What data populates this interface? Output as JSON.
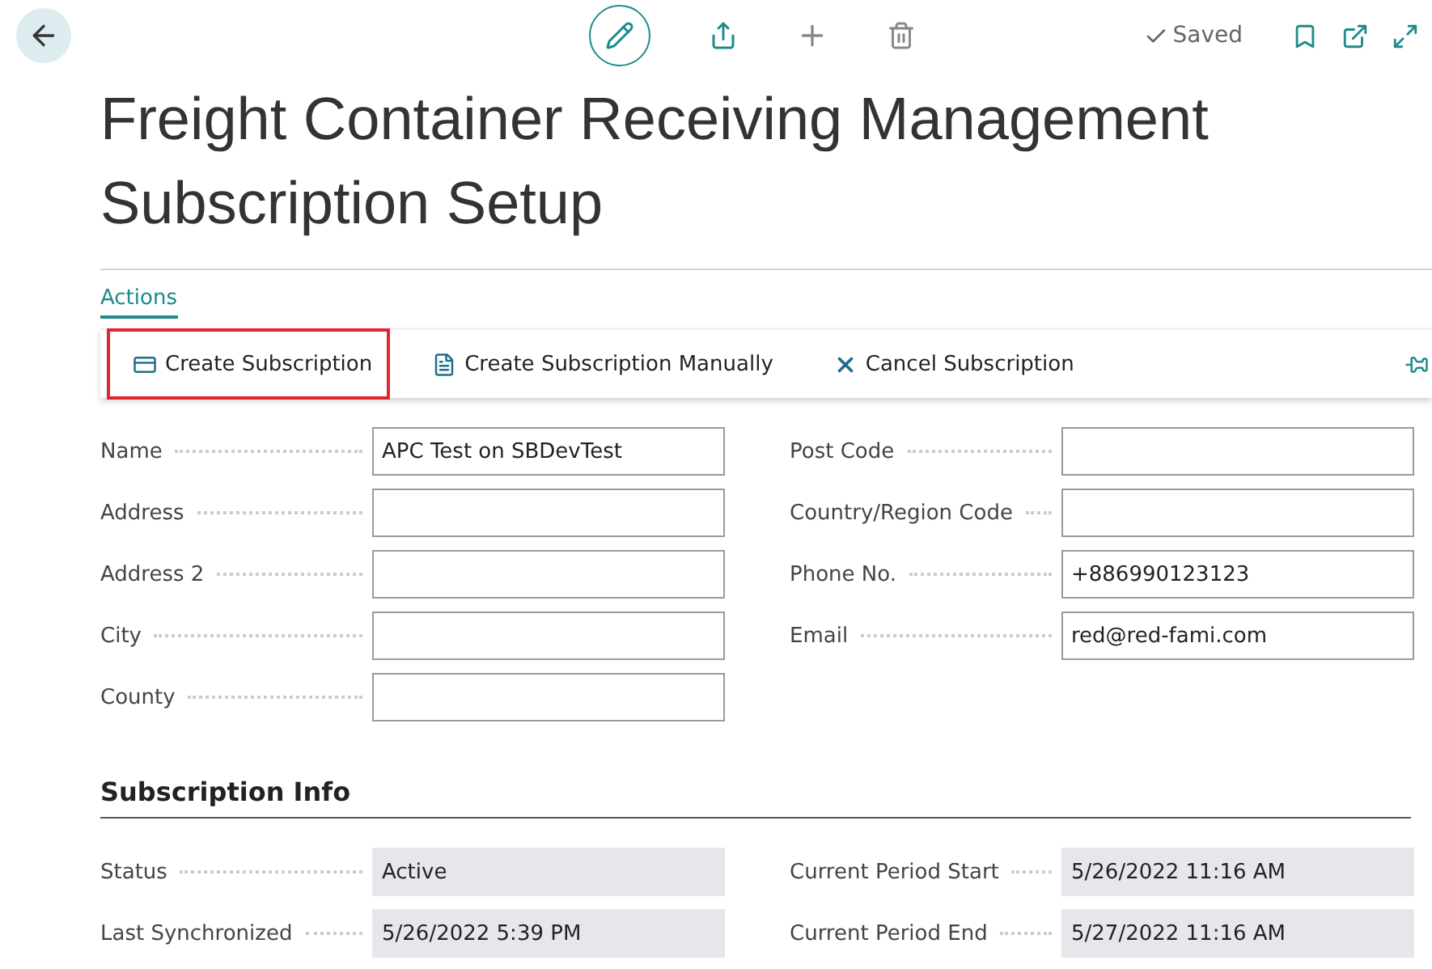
{
  "header": {
    "status": "Saved"
  },
  "title": "Freight Container Receiving Management Subscription Setup",
  "actions_tab": {
    "label": "Actions",
    "selected": true
  },
  "actions": [
    {
      "kind": "card",
      "label": "Create Subscription",
      "highlighted": true
    },
    {
      "kind": "form",
      "label": "Create Subscription Manually",
      "highlighted": false
    },
    {
      "kind": "cancel",
      "label": "Cancel Subscription",
      "highlighted": false
    }
  ],
  "general": {
    "left": [
      {
        "label": "Name",
        "value": "APC Test on SBDevTest"
      },
      {
        "label": "Address"
      },
      {
        "label": "Address 2"
      },
      {
        "label": "City"
      },
      {
        "label": "County"
      }
    ],
    "right": [
      {
        "label": "Post Code"
      },
      {
        "label": "Country/Region Code"
      },
      {
        "label": "Phone No.",
        "value": "+886990123123"
      },
      {
        "label": "Email",
        "value": "red@red-fami.com"
      }
    ]
  },
  "subscription_info": {
    "title": "Subscription Info",
    "left": [
      {
        "label": "Status",
        "value": "Active"
      },
      {
        "label": "Last Synchronized",
        "value": "5/26/2022 5:39 PM"
      }
    ],
    "right": [
      {
        "label": "Current Period Start",
        "value": "5/26/2022 11:16 AM"
      },
      {
        "label": "Current Period End",
        "value": "5/27/2022 11:16 AM"
      }
    ]
  }
}
